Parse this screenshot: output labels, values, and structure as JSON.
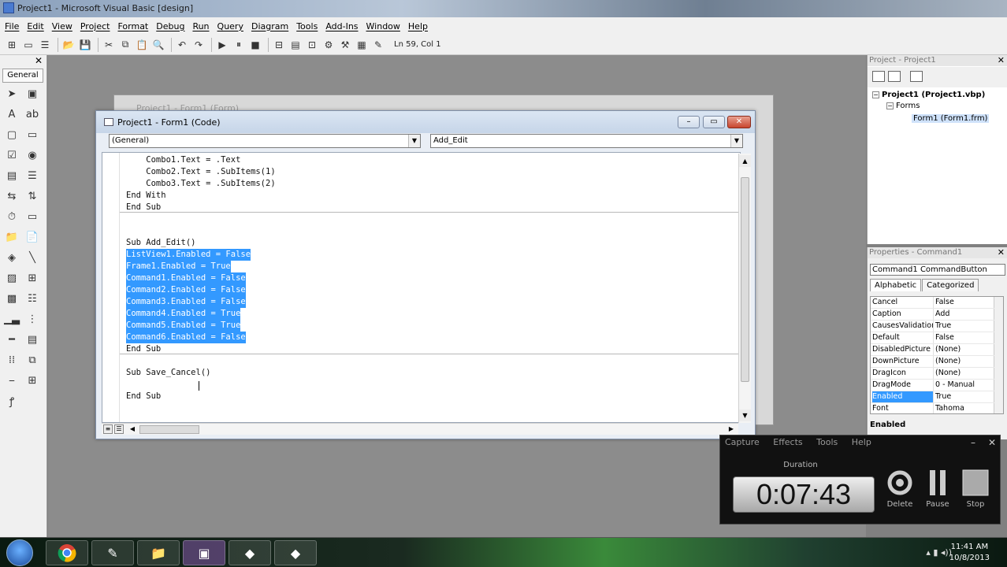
{
  "window": {
    "title": "Project1 - Microsoft Visual Basic [design]"
  },
  "menu": [
    "File",
    "Edit",
    "View",
    "Project",
    "Format",
    "Debug",
    "Run",
    "Query",
    "Diagram",
    "Tools",
    "Add-Ins",
    "Window",
    "Help"
  ],
  "toolbar": {
    "position": "Ln 59, Col 1"
  },
  "toolbox": {
    "tab_label": "General"
  },
  "form_designer": {
    "title": "Project1 - Form1 (Form)"
  },
  "code_window": {
    "title": "Project1 - Form1 (Code)",
    "object_combo": "(General)",
    "procedure_combo": "Add_Edit",
    "lines": [
      {
        "text": "    Combo1.Text = .Text",
        "selected": false
      },
      {
        "text": "    Combo2.Text = .SubItems(1)",
        "selected": false
      },
      {
        "text": "    Combo3.Text = .SubItems(2)",
        "selected": false
      },
      {
        "text": "End With",
        "selected": false
      },
      {
        "text": "End Sub",
        "selected": false
      },
      {
        "text": "",
        "selected": false
      },
      {
        "text": "",
        "selected": false
      },
      {
        "text": "Sub Add_Edit()",
        "selected": false
      },
      {
        "text": "ListView1.Enabled = False",
        "selected": true
      },
      {
        "text": "Frame1.Enabled = True",
        "selected": true
      },
      {
        "text": "Command1.Enabled = False",
        "selected": true
      },
      {
        "text": "Command2.Enabled = False",
        "selected": true
      },
      {
        "text": "Command3.Enabled = False",
        "selected": true
      },
      {
        "text": "Command4.Enabled = True",
        "selected": true
      },
      {
        "text": "Command5.Enabled = True",
        "selected": true
      },
      {
        "text": "Command6.Enabled = False",
        "selected": true
      },
      {
        "text": "End Sub",
        "selected": false
      },
      {
        "text": "",
        "selected": false
      },
      {
        "text": "Sub Save_Cancel()",
        "selected": false
      },
      {
        "text": "",
        "selected": false
      },
      {
        "text": "End Sub",
        "selected": false
      }
    ]
  },
  "project_explorer": {
    "header": "Project - Project1",
    "root": "Project1 (Project1.vbp)",
    "folder": "Forms",
    "item": "Form1 (Form1.frm)"
  },
  "properties": {
    "header": "Properties - Command1",
    "object": "Command1 CommandButton",
    "tabs": [
      "Alphabetic",
      "Categorized"
    ],
    "rows": [
      {
        "name": "Cancel",
        "value": "False",
        "selected": false
      },
      {
        "name": "Caption",
        "value": "Add",
        "selected": false
      },
      {
        "name": "CausesValidation",
        "value": "True",
        "selected": false
      },
      {
        "name": "Default",
        "value": "False",
        "selected": false
      },
      {
        "name": "DisabledPicture",
        "value": "(None)",
        "selected": false
      },
      {
        "name": "DownPicture",
        "value": "(None)",
        "selected": false
      },
      {
        "name": "DragIcon",
        "value": "(None)",
        "selected": false
      },
      {
        "name": "DragMode",
        "value": "0 - Manual",
        "selected": false
      },
      {
        "name": "Enabled",
        "value": "True",
        "selected": true
      },
      {
        "name": "Font",
        "value": "Tahoma",
        "selected": false
      }
    ],
    "description": "Enabled"
  },
  "recorder": {
    "menu": [
      "Capture",
      "Effects",
      "Tools",
      "Help"
    ],
    "duration_label": "Duration",
    "time": "0:07:43",
    "buttons": [
      "Delete",
      "Pause",
      "Stop"
    ]
  },
  "taskbar": {
    "time": "11:41 AM",
    "date": "10/8/2013"
  },
  "colors": {
    "selection": "#3399ff",
    "workspace": "#8c8c8c"
  }
}
